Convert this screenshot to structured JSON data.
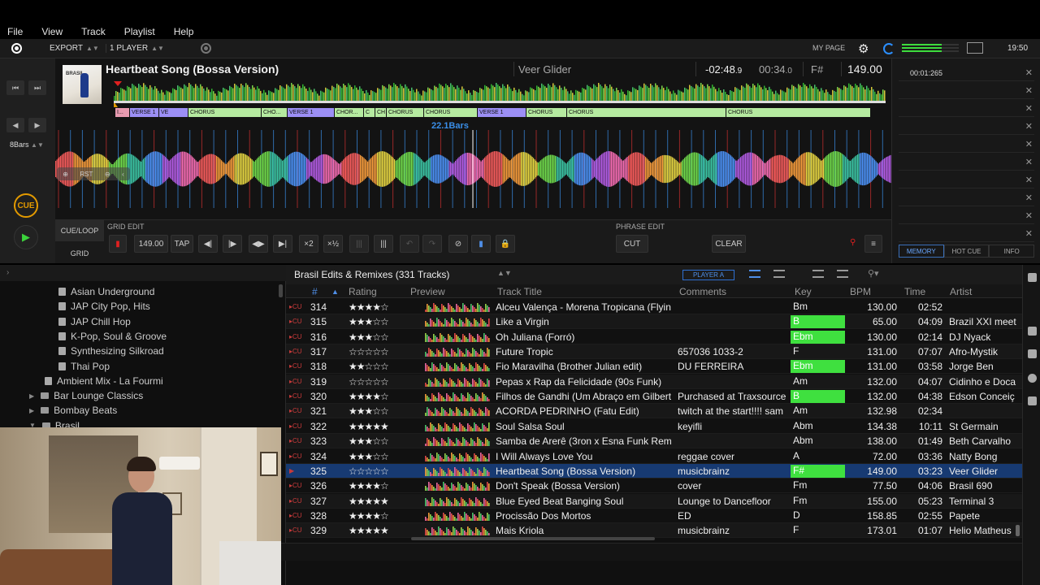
{
  "menu": [
    "File",
    "View",
    "Track",
    "Playlist",
    "Help"
  ],
  "toolbar": {
    "export_label": "EXPORT",
    "player_label": "1 PLAYER",
    "my_page": "MY PAGE",
    "clock": "19:50"
  },
  "deck": {
    "title": "Heartbeat Song (Bossa Version)",
    "artist": "Veer Glider",
    "remain_main": "-02:48",
    "remain_frac": ".9",
    "elapsed_main": "00:34",
    "elapsed_frac": ".0",
    "key": "F#",
    "bpm": "149.00",
    "art_text": "BRASIL",
    "zoom_label": "22.1Bars",
    "bars_label": "8Bars",
    "cue_label": "CUE",
    "phrases": [
      {
        "label": "I...",
        "type": "i"
      },
      {
        "label": "VERSE 1",
        "type": "v"
      },
      {
        "label": "VE",
        "type": "v"
      },
      {
        "label": "CHORUS",
        "type": "c"
      },
      {
        "label": "CHO...",
        "type": "c"
      },
      {
        "label": "VERSE 1",
        "type": "v"
      },
      {
        "label": "CHOR...",
        "type": "c"
      },
      {
        "label": "C",
        "type": "c"
      },
      {
        "label": "CH",
        "type": "c"
      },
      {
        "label": "CHORUS",
        "type": "c"
      },
      {
        "label": "CHORUS",
        "type": "c"
      },
      {
        "label": "VERSE 1",
        "type": "v"
      },
      {
        "label": "CHORUS",
        "type": "c"
      },
      {
        "label": "CHORUS",
        "type": "c"
      },
      {
        "label": "CHORUS",
        "type": "c"
      }
    ],
    "edit": {
      "cue_loop_tab": "CUE/LOOP",
      "grid_tab": "GRID",
      "grid_edit_label": "GRID EDIT",
      "bpm_field": "149.00",
      "tap": "TAP",
      "x2": "×2",
      "x_half": "×½",
      "phrase_edit_label": "PHRASE EDIT",
      "cut": "CUT",
      "clear": "CLEAR"
    }
  },
  "memory": {
    "first_time": "00:01:265",
    "tabs": [
      "MEMORY",
      "HOT CUE",
      "INFO"
    ]
  },
  "tree": {
    "items": [
      {
        "label": "Asian Underground",
        "kind": "playlist",
        "indent": 2
      },
      {
        "label": "JAP City Pop, Hits",
        "kind": "playlist",
        "indent": 2
      },
      {
        "label": "JAP Chill Hop",
        "kind": "playlist",
        "indent": 2
      },
      {
        "label": "K-Pop, Soul & Groove",
        "kind": "playlist",
        "indent": 2
      },
      {
        "label": "Synthesizing Silkroad",
        "kind": "playlist",
        "indent": 2
      },
      {
        "label": "Thai Pop",
        "kind": "playlist",
        "indent": 2
      },
      {
        "label": "Ambient Mix - La Fourmi",
        "kind": "playlist",
        "indent": 1
      },
      {
        "label": "Bar Lounge Classics",
        "kind": "folder",
        "indent": 1
      },
      {
        "label": "Bombay Beats",
        "kind": "folder",
        "indent": 1
      },
      {
        "label": "Brasil",
        "kind": "folder",
        "indent": 1
      }
    ]
  },
  "list": {
    "title": "Brasil Edits & Remixes (331 Tracks)",
    "player": "PLAYER A",
    "columns": [
      "#",
      "Rating",
      "Preview",
      "Track Title",
      "Comments",
      "Key",
      "BPM",
      "Time",
      "Artist"
    ],
    "rows": [
      {
        "num": "314",
        "rating": "★★★★☆",
        "title": "Alceu Valença - Morena Tropicana (Flyin",
        "comment": "",
        "key": "Bm",
        "key_hl": false,
        "bpm": "130.00",
        "time": "02:52",
        "artist": "",
        "selected": false
      },
      {
        "num": "315",
        "rating": "★★★☆☆",
        "title": "Like a Virgin",
        "comment": "",
        "key": "B",
        "key_hl": true,
        "bpm": "65.00",
        "time": "04:09",
        "artist": "Brazil XXI meet",
        "selected": false
      },
      {
        "num": "316",
        "rating": "★★★☆☆",
        "title": "Oh Juliana (Forró)",
        "comment": "",
        "key": "Ebm",
        "key_hl": true,
        "bpm": "130.00",
        "time": "02:14",
        "artist": "DJ Nyack",
        "selected": false
      },
      {
        "num": "317",
        "rating": "☆☆☆☆☆",
        "title": "Future Tropic",
        "comment": "657036 1033-2",
        "key": "F",
        "key_hl": false,
        "bpm": "131.00",
        "time": "07:07",
        "artist": "Afro-Mystik",
        "selected": false
      },
      {
        "num": "318",
        "rating": "★★☆☆☆",
        "title": "Fio Maravilha (Brother Julian edit)",
        "comment": "DU FERREIRA",
        "key": "Ebm",
        "key_hl": true,
        "bpm": "131.00",
        "time": "03:58",
        "artist": "Jorge Ben",
        "selected": false
      },
      {
        "num": "319",
        "rating": "☆☆☆☆☆",
        "title": "Pepas x Rap da Felicidade (90s Funk)",
        "comment": "",
        "key": "Am",
        "key_hl": false,
        "bpm": "132.00",
        "time": "04:07",
        "artist": "Cidinho e Doca",
        "selected": false
      },
      {
        "num": "320",
        "rating": "★★★★☆",
        "title": "Filhos de Gandhi (Um Abraço em Gilbert",
        "comment": "Purchased at Traxsource",
        "key": "B",
        "key_hl": true,
        "bpm": "132.00",
        "time": "04:38",
        "artist": "Edson Conceiç",
        "selected": false
      },
      {
        "num": "321",
        "rating": "★★★☆☆",
        "title": "ACORDA PEDRINHO (Fatu Edit)",
        "comment": "twitch at the start!!!! sam",
        "key": "Am",
        "key_hl": false,
        "bpm": "132.98",
        "time": "02:34",
        "artist": "",
        "selected": false
      },
      {
        "num": "322",
        "rating": "★★★★★",
        "title": "Soul Salsa Soul",
        "comment": "keyifli",
        "key": "Abm",
        "key_hl": false,
        "bpm": "134.38",
        "time": "10:11",
        "artist": "St Germain",
        "selected": false
      },
      {
        "num": "323",
        "rating": "★★★☆☆",
        "title": "Samba de Arerê (3ron x Esna Funk Rem",
        "comment": "",
        "key": "Abm",
        "key_hl": false,
        "bpm": "138.00",
        "time": "01:49",
        "artist": "Beth Carvalho",
        "selected": false
      },
      {
        "num": "324",
        "rating": "★★★☆☆",
        "title": "I Will Always Love You",
        "comment": "reggae cover",
        "key": "A",
        "key_hl": false,
        "bpm": "72.00",
        "time": "03:36",
        "artist": "Natty Bong",
        "selected": false
      },
      {
        "num": "325",
        "rating": "☆☆☆☆☆",
        "title": "Heartbeat Song (Bossa Version)",
        "comment": "musicbrainz",
        "key": "F#",
        "key_hl": true,
        "bpm": "149.00",
        "time": "03:23",
        "artist": "Veer Glider",
        "selected": true
      },
      {
        "num": "326",
        "rating": "★★★★☆",
        "title": "Don't Speak (Bossa Version)",
        "comment": "cover",
        "key": "Fm",
        "key_hl": false,
        "bpm": "77.50",
        "time": "04:06",
        "artist": "Brasil 690",
        "selected": false
      },
      {
        "num": "327",
        "rating": "★★★★★",
        "title": "Blue Eyed Beat Banging Soul",
        "comment": "Lounge to Dancefloor",
        "key": "Fm",
        "key_hl": false,
        "bpm": "155.00",
        "time": "05:23",
        "artist": "Terminal 3",
        "selected": false
      },
      {
        "num": "328",
        "rating": "★★★★☆",
        "title": "Procissão Dos Mortos",
        "comment": "ED",
        "key": "D",
        "key_hl": false,
        "bpm": "158.85",
        "time": "02:55",
        "artist": "Papete",
        "selected": false
      },
      {
        "num": "329",
        "rating": "★★★★★",
        "title": "Mais Kriola",
        "comment": "musicbrainz",
        "key": "F",
        "key_hl": false,
        "bpm": "173.01",
        "time": "01:07",
        "artist": "Helio Matheus",
        "selected": false
      }
    ]
  },
  "colors": {
    "accent_blue": "#2e6fd0",
    "key_highlight": "#3fe03f",
    "cue_orange": "#e39a00",
    "selected_row": "#173a72"
  }
}
